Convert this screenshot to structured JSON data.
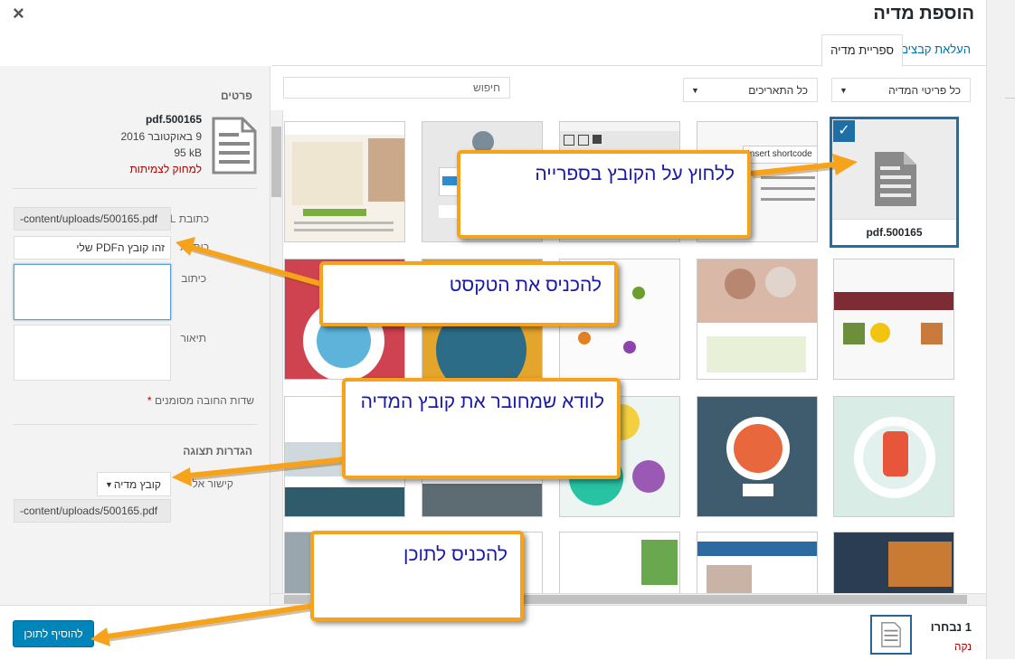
{
  "modal": {
    "title": "הוספת מדיה",
    "close_symbol": "×"
  },
  "tabs": {
    "upload": "העלאת קבצים",
    "library": "ספריית מדיה"
  },
  "filters": {
    "type_select": "כל פריטי המדיה",
    "date_select": "כל התאריכים",
    "search_placeholder": "חיפוש"
  },
  "details": {
    "heading": "פרטים",
    "filename": "pdf.500165",
    "date": "9 באוקטובר 2016",
    "size": "95 kB",
    "delete_link": "למחוק לצמיתות",
    "url_label": "כתובת URL",
    "url_value": "-content/uploads/500165.pdf",
    "title_label": "כותרת",
    "title_value": "זהו קובץ הPDF שלי",
    "caption_label": "כיתוב",
    "description_label": "תיאור",
    "required_note": "שדות החובה מסומנים",
    "required_star": "*"
  },
  "display": {
    "heading": "הגדרות תצוגה",
    "link_label": "קישור אל",
    "link_select": "קובץ מדיה",
    "link_url": "-content/uploads/500165.pdf"
  },
  "grid": {
    "selected_tile_label": "pdf.500165",
    "shortcode_text": "Insert shortcode"
  },
  "footer": {
    "selected_count": "1 נבחרו",
    "clear_link": "נקה",
    "insert_button": "להוסיף לתוכן"
  },
  "callouts": {
    "click_file": "ללחוץ על הקובץ בספרייה",
    "enter_text": "להכניס את הטקסט",
    "ensure_linked": "לוודא שמחובר את קובץ המדיה",
    "insert_content": "להכניס לתוכן"
  },
  "colors": {
    "accent": "#0085ba",
    "callout_border": "#f7a21b",
    "callout_text": "#1a1aa8",
    "arrow": "#f7a21b",
    "delete": "#aa0000"
  }
}
